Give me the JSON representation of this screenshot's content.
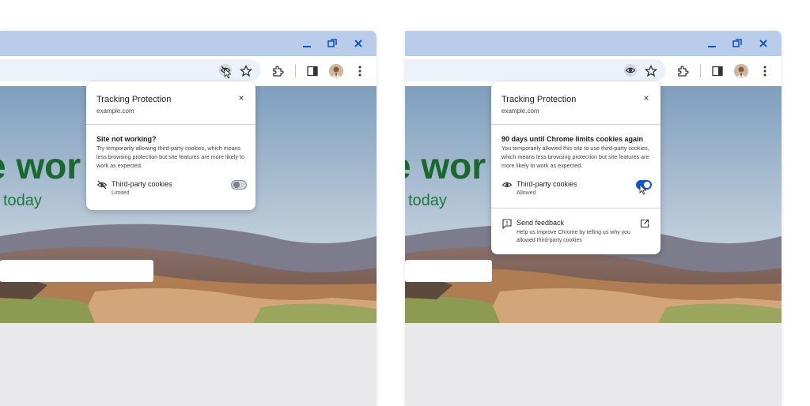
{
  "left": {
    "headline": "e wor",
    "subline": "today",
    "popup": {
      "title": "Tracking Protection",
      "site": "example.com",
      "close": "×",
      "heading": "Site not working?",
      "body": "Try temporarily allowing third-party cookies, which means less browsing protection but site features are more likely to work as expected.",
      "cookies_label": "Third-party cookies",
      "cookies_status": "Limited",
      "toggle_on": false
    }
  },
  "right": {
    "headline": "e wor",
    "subline": "today",
    "popup": {
      "title": "Tracking Protection",
      "site": "example.com",
      "close": "×",
      "heading": "90 days until Chrome limits cookies again",
      "body": "You temporarily allowed this site to use third-party cookies, which means less browsing protection but site features are more likely to work as expected.",
      "cookies_label": "Third-party cookies",
      "cookies_status": "Allowed",
      "toggle_on": true,
      "feedback_label": "Send feedback",
      "feedback_body": "Help us improve Chrome by telling us why you allowed third-party cookies"
    }
  },
  "colors": {
    "titlebar": "#b9cdea",
    "omnibox": "#edf2fa",
    "headline": "#18682f",
    "toggle_on": "#0b57d0",
    "window_controls": "#0b57d0"
  },
  "icons": {
    "minimize": "minimize-icon",
    "restore": "restore-icon",
    "close": "close-icon",
    "tracking_off": "eye-slash-icon",
    "tracking_on": "eye-icon",
    "bookmark": "star-icon",
    "extensions": "puzzle-icon",
    "side_panel": "side-panel-icon",
    "menu": "kebab-menu-icon",
    "feedback": "feedback-icon",
    "open_external": "open-external-icon"
  }
}
